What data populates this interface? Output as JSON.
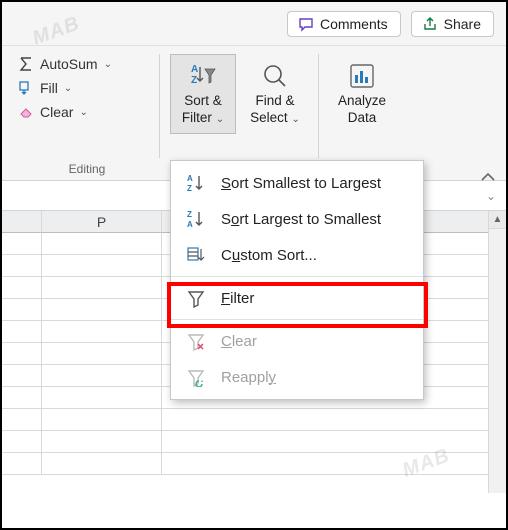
{
  "topbar": {
    "comments_label": "Comments",
    "share_label": "Share"
  },
  "editing_group": {
    "autosum_label": "AutoSum",
    "fill_label": "Fill",
    "clear_label": "Clear",
    "group_label": "Editing"
  },
  "big_cmds": {
    "sort_filter_l1": "Sort &",
    "sort_filter_l2": "Filter",
    "find_select_l1": "Find &",
    "find_select_l2": "Select",
    "analyze_l1": "Analyze",
    "analyze_l2": "Data"
  },
  "menu": {
    "sort_asc": "Sort Smallest to Largest",
    "sort_desc": "Sort Largest to Smallest",
    "custom_sort": "Custom Sort...",
    "filter": "Filter",
    "clear": "Clear",
    "reapply": "Reapply"
  },
  "sheet": {
    "col_p": "P"
  },
  "watermark": "MAB",
  "formula_dropdown": "⌄"
}
